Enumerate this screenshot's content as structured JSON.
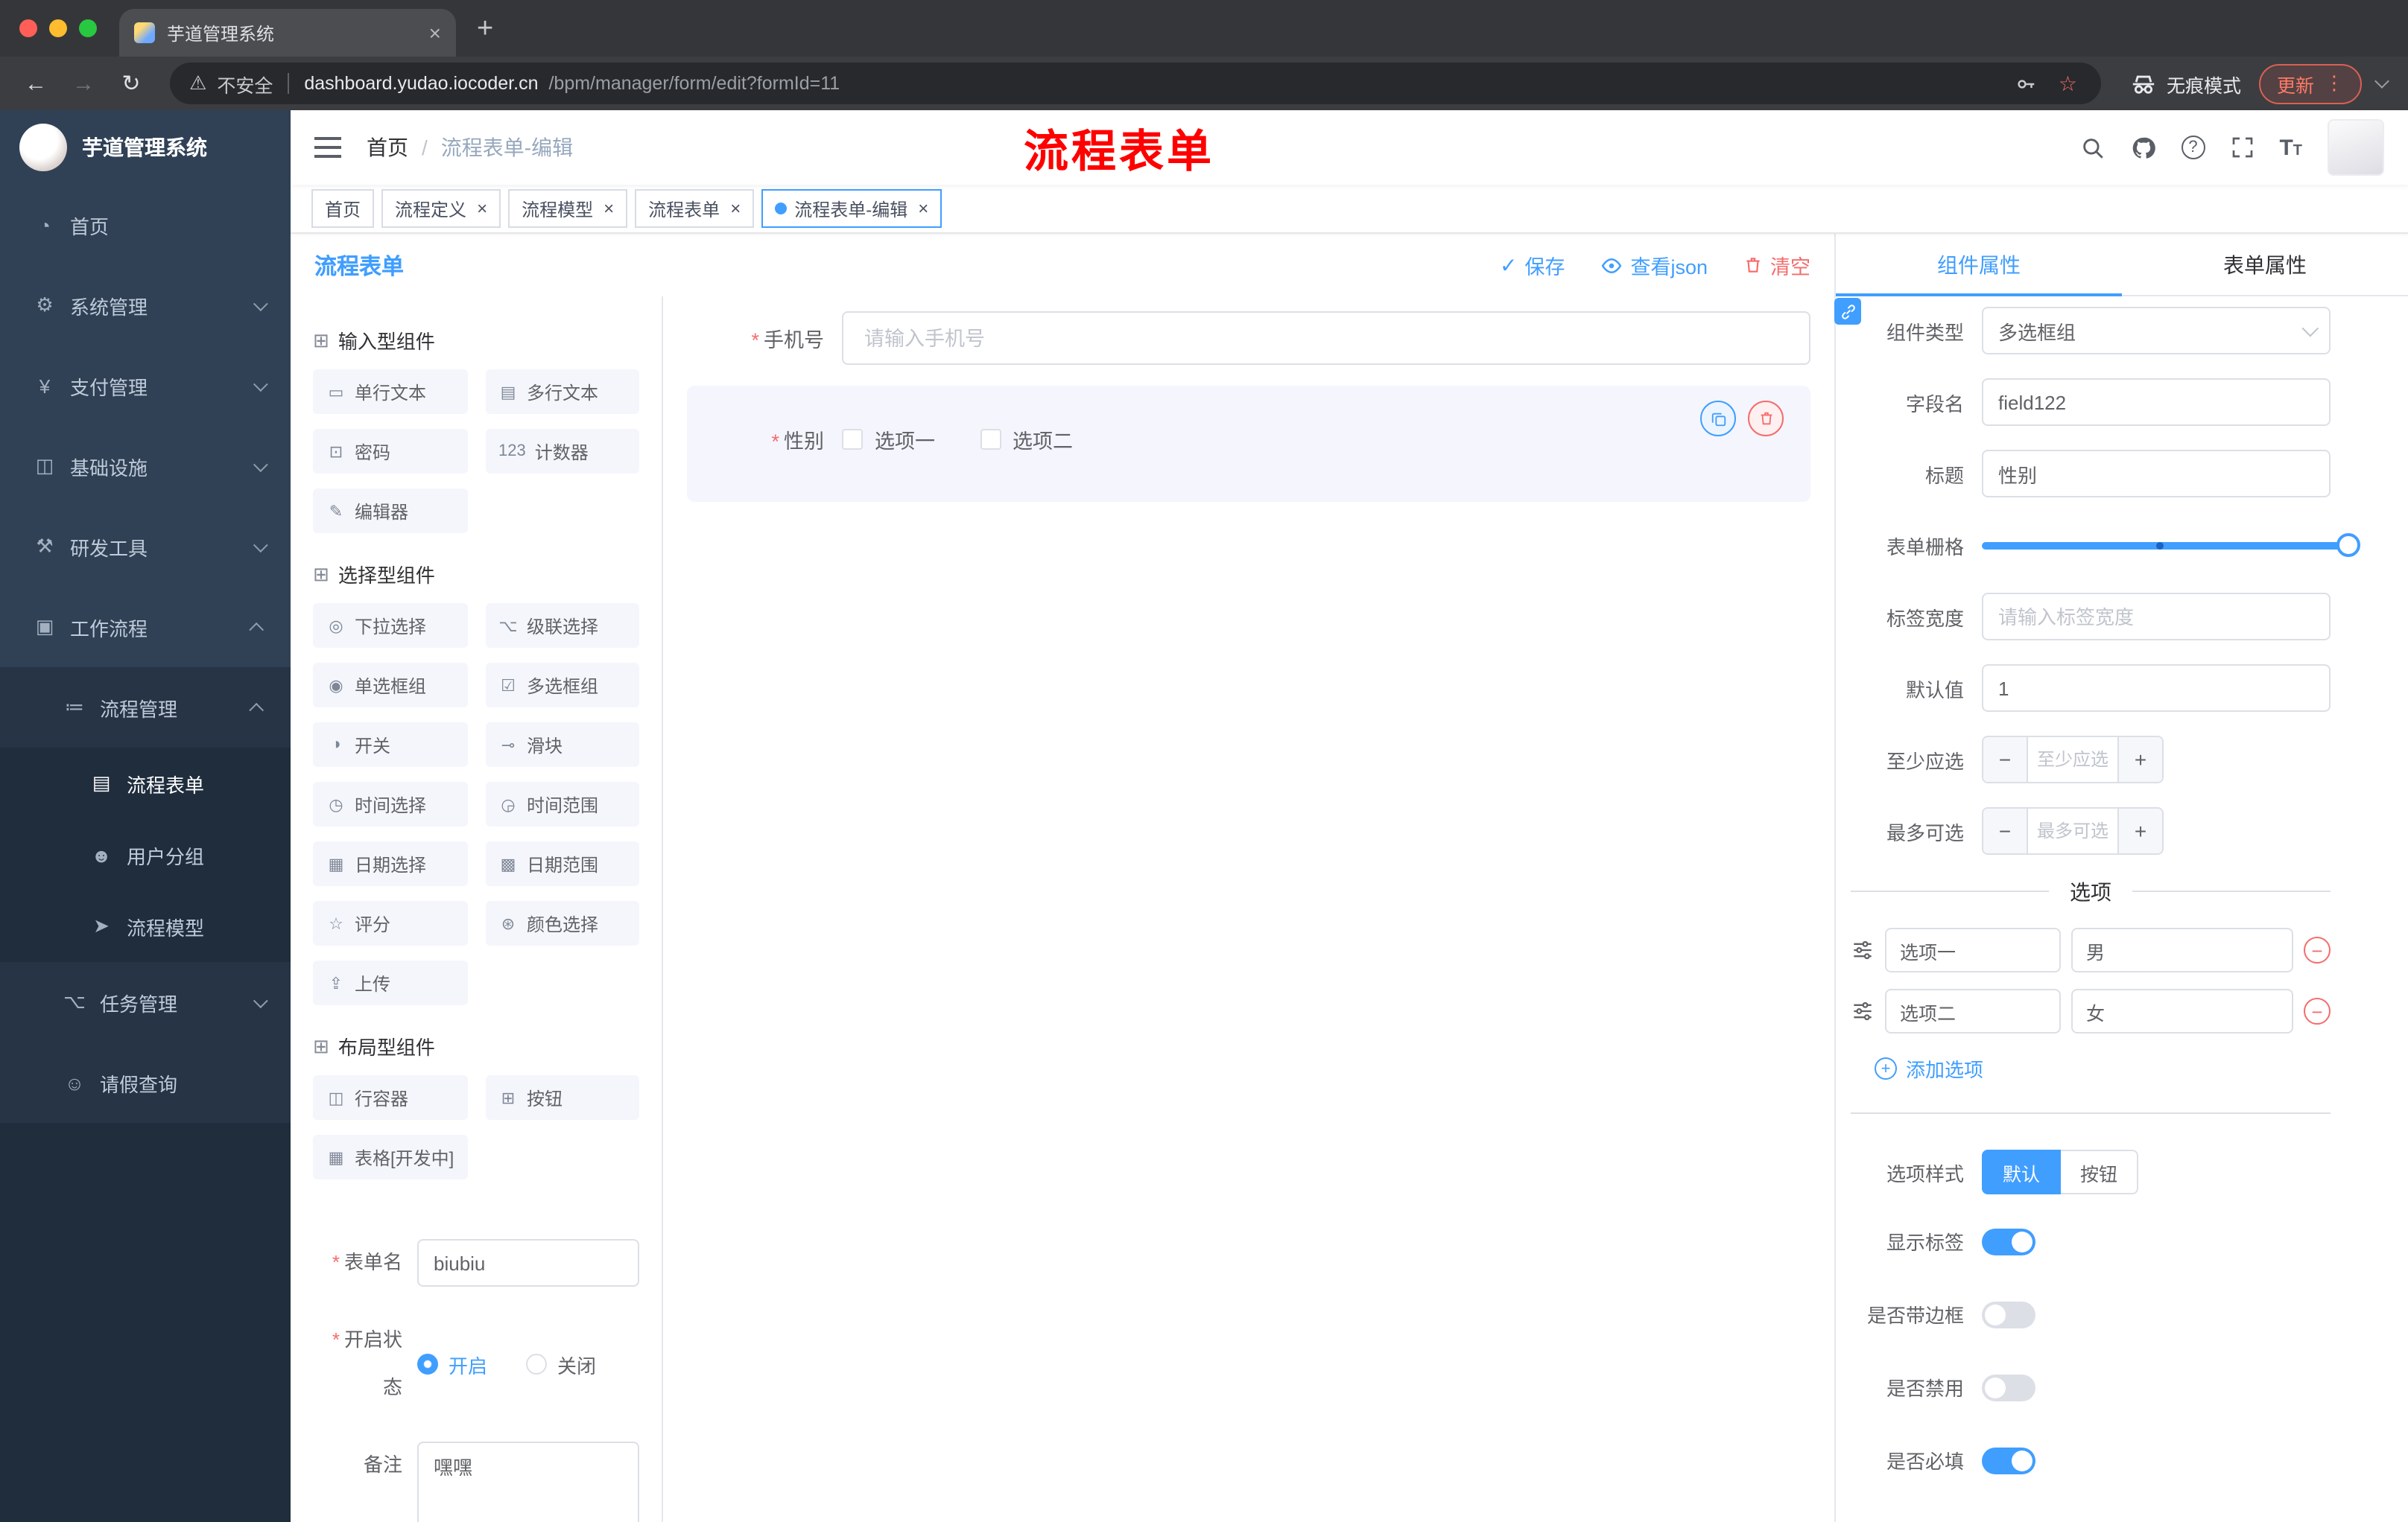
{
  "colors": {
    "primary": "#409eff",
    "danger": "#f56c6c",
    "sidebar_bg": "#304156",
    "sidebar_sub_bg": "#263445",
    "sidebar_deep_bg": "#1f2d3d",
    "annotation_red": "#ff0000"
  },
  "browser": {
    "tab_title": "芋道管理系统",
    "security_label": "不安全",
    "url_domain": "dashboard.yudao.iocoder.cn",
    "url_path": "/bpm/manager/form/edit?formId=11",
    "incognito_label": "无痕模式",
    "update_label": "更新"
  },
  "sidebar": {
    "logo_title": "芋道管理系统",
    "items": [
      {
        "icon": "◔",
        "label": "首页"
      },
      {
        "icon": "⚙",
        "label": "系统管理"
      },
      {
        "icon": "¥",
        "label": "支付管理"
      },
      {
        "icon": "◫",
        "label": "基础设施"
      },
      {
        "icon": "⚒",
        "label": "研发工具"
      },
      {
        "icon": "▣",
        "label": "工作流程"
      },
      {
        "icon": "≔",
        "label": "流程管理"
      },
      {
        "icon": "▤",
        "label": "流程表单"
      },
      {
        "icon": "☻",
        "label": "用户分组"
      },
      {
        "icon": "➤",
        "label": "流程模型"
      },
      {
        "icon": "⌥",
        "label": "任务管理"
      },
      {
        "icon": "☺",
        "label": "请假查询"
      }
    ]
  },
  "header": {
    "breadcrumb_home": "首页",
    "breadcrumb_current": "流程表单-编辑",
    "annotation": "流程表单"
  },
  "tags": [
    {
      "label": "首页"
    },
    {
      "label": "流程定义"
    },
    {
      "label": "流程模型"
    },
    {
      "label": "流程表单"
    },
    {
      "label": "流程表单-编辑"
    }
  ],
  "builder": {
    "panel_title": "流程表单",
    "toolbar": {
      "save": "保存",
      "view_json": "查看json",
      "clear": "清空"
    },
    "groups": [
      {
        "title": "输入型组件",
        "items": [
          {
            "icon": "▭",
            "label": "单行文本"
          },
          {
            "icon": "▤",
            "label": "多行文本"
          },
          {
            "icon": "⊡",
            "label": "密码"
          },
          {
            "icon": "123",
            "label": "计数器"
          },
          {
            "icon": "✎",
            "label": "编辑器"
          }
        ]
      },
      {
        "title": "选择型组件",
        "items": [
          {
            "icon": "◎",
            "label": "下拉选择"
          },
          {
            "icon": "⌥",
            "label": "级联选择"
          },
          {
            "icon": "◉",
            "label": "单选框组"
          },
          {
            "icon": "☑",
            "label": "多选框组"
          },
          {
            "icon": "◑",
            "label": "开关"
          },
          {
            "icon": "⊸",
            "label": "滑块"
          },
          {
            "icon": "◷",
            "label": "时间选择"
          },
          {
            "icon": "◶",
            "label": "时间范围"
          },
          {
            "icon": "▦",
            "label": "日期选择"
          },
          {
            "icon": "▩",
            "label": "日期范围"
          },
          {
            "icon": "☆",
            "label": "评分"
          },
          {
            "icon": "⊛",
            "label": "颜色选择"
          },
          {
            "icon": "⇪",
            "label": "上传"
          }
        ]
      },
      {
        "title": "布局型组件",
        "items": [
          {
            "icon": "◫",
            "label": "行容器"
          },
          {
            "icon": "⊞",
            "label": "按钮"
          },
          {
            "icon": "▦",
            "label": "表格[开发中]"
          }
        ]
      }
    ],
    "form": {
      "form_name_label": "表单名",
      "form_name_value": "biubiu",
      "status_label": "开启状态",
      "status_on": "开启",
      "status_off": "关闭",
      "remark_label": "备注",
      "remark_value": "嘿嘿"
    }
  },
  "canvas": {
    "phone_label": "手机号",
    "phone_placeholder": "请输入手机号",
    "gender_label": "性别",
    "gender_options": [
      "选项一",
      "选项二"
    ]
  },
  "properties": {
    "tab_component": "组件属性",
    "tab_form": "表单属性",
    "component_type_label": "组件类型",
    "component_type_value": "多选框组",
    "field_name_label": "字段名",
    "field_name_value": "field122",
    "title_label": "标题",
    "title_value": "性别",
    "grid_label": "表单栅格",
    "label_width_label": "标签宽度",
    "label_width_placeholder": "请输入标签宽度",
    "default_label": "默认值",
    "default_value": "1",
    "min_label": "至少应选",
    "min_placeholder": "至少应选",
    "max_label": "最多可选",
    "max_placeholder": "最多可选",
    "options_title": "选项",
    "options": [
      {
        "label": "选项一",
        "value": "男"
      },
      {
        "label": "选项二",
        "value": "女"
      }
    ],
    "add_option_label": "添加选项",
    "style_label": "选项样式",
    "style_options": [
      "默认",
      "按钮"
    ],
    "toggles": [
      {
        "label": "显示标签",
        "on": true
      },
      {
        "label": "是否带边框",
        "on": false
      },
      {
        "label": "是否禁用",
        "on": false
      },
      {
        "label": "是否必填",
        "on": true
      }
    ]
  }
}
